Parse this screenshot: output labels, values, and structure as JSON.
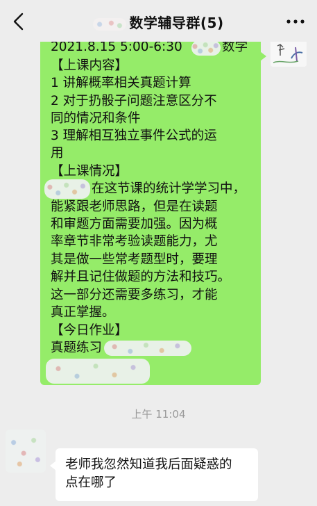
{
  "header": {
    "title": "数学辅导群(5)",
    "back_icon": "chevron-left-icon",
    "more_icon": "more-dots-icon"
  },
  "sent_message": {
    "lines": [
      "2021.8.15  5:00-6:30",
      "数学",
      "【上课内容】",
      "1  讲解概率相关真题计算",
      "2  对于扔骰子问题注意区分不",
      "同的情况和条件",
      "3  理解相互独立事件公式的运",
      "用",
      "【上课情况】",
      "在这节课的统计学学习中，",
      "能紧跟老师思路，但是在读题",
      "和审题方面需要加强。因为概",
      "率章节非常考验读题能力，尤",
      "其是做一些常考题型时，要理",
      "解并且记住做题的方法和技巧。",
      "这一部分还需要多练习，才能",
      "真正掌握。",
      "【今日作业】",
      "真题练习"
    ],
    "bubble_color": "#95ec69"
  },
  "timestamp": "上午 11:04",
  "received_message": {
    "lines": [
      "老师我忽然知道我后面疑惑的",
      "点在哪了"
    ],
    "bubble_color": "#ffffff"
  },
  "colors": {
    "background": "#ededed",
    "timestamp": "#9a9a9a"
  }
}
